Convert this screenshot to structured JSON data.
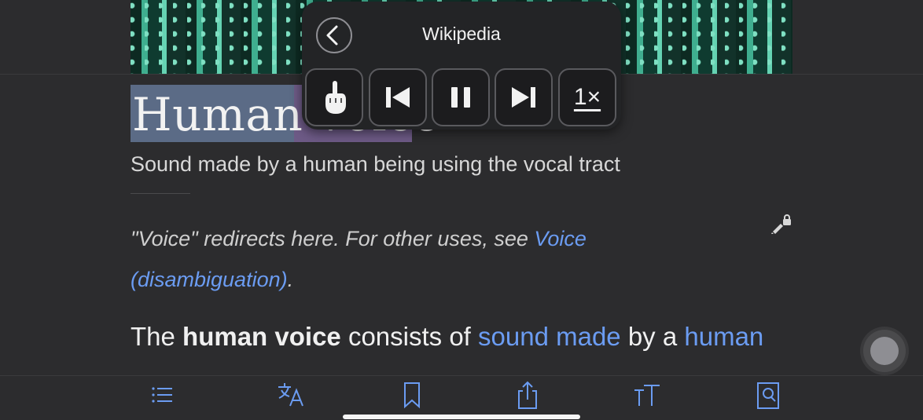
{
  "article": {
    "title": "Human voice",
    "subtitle": "Sound made by a human being using the vocal tract",
    "hatnote": {
      "prefix": "\"Voice\" redirects here. For other uses, see ",
      "link": "Voice (disambiguation)",
      "suffix": "."
    },
    "body": {
      "w1": "The ",
      "b1": "human voice",
      "w2": " consists of ",
      "l1": "sound made",
      "w3": " by a ",
      "l2": "human"
    }
  },
  "speech_panel": {
    "title": "Wikipedia",
    "speed_label": "1×"
  },
  "colors": {
    "link": "#6b9cf2",
    "background": "#2c2c2e",
    "title_highlight_word": "#5b6b86",
    "title_highlight_next": "#6d5a86"
  },
  "icons": {
    "panel": [
      "back-icon",
      "touch-icon",
      "previous-icon",
      "pause-icon",
      "next-icon"
    ],
    "toolbar": [
      "contents-icon",
      "translate-icon",
      "bookmark-icon",
      "share-icon",
      "text-size-icon",
      "find-icon"
    ]
  }
}
